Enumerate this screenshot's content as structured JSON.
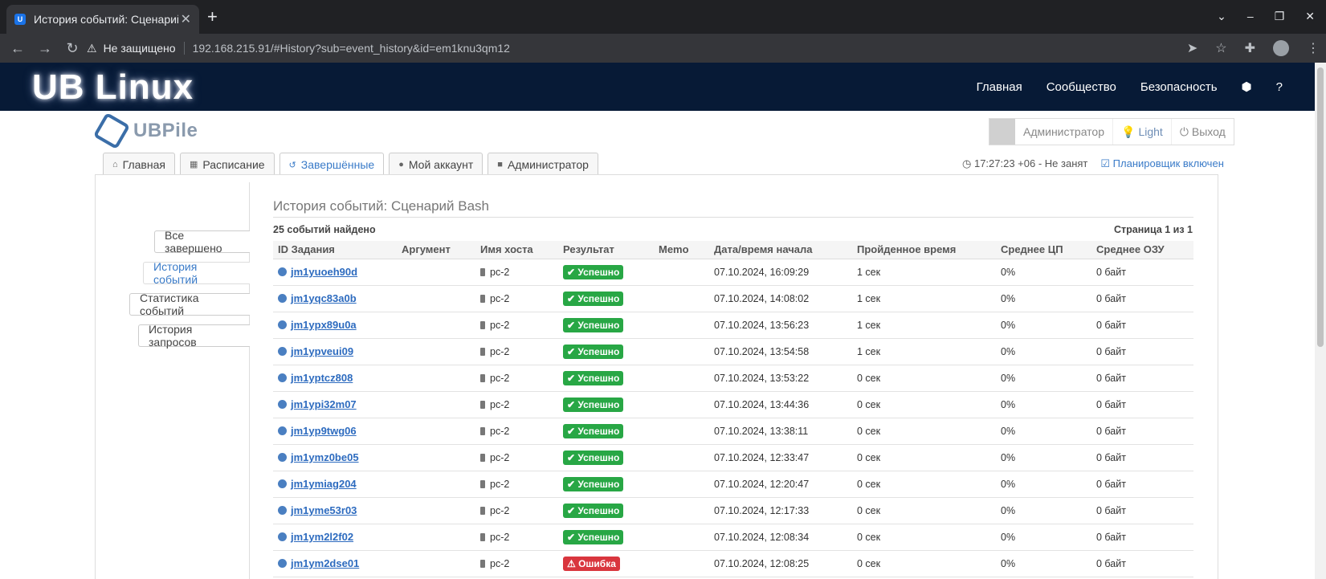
{
  "browser": {
    "tab_title": "История событий: Сценарий",
    "tab_favicon": "U",
    "security_label": "Не защищено",
    "url": "192.168.215.91/#History?sub=event_history&id=em1knu3qm12"
  },
  "site": {
    "logo": "UB Linux",
    "nav": [
      "Главная",
      "Сообщество",
      "Безопасность",
      "⬢",
      "?"
    ]
  },
  "app": {
    "name": "UBPile",
    "user": "Администратор",
    "theme": "Light",
    "logout": "Выход",
    "tabs": [
      "Главная",
      "Расписание",
      "Завершённые",
      "Мой аккаунт",
      "Администратор"
    ],
    "active_tab": 2,
    "time_status": "17:27:23 +06 - Не занят",
    "scheduler": "Планировщик включен"
  },
  "sidebar": {
    "items": [
      "Все завершено",
      "История событий",
      "Статистика событий",
      "История запросов"
    ],
    "active": 1
  },
  "content": {
    "title": "История событий: Сценарий Bash",
    "count": "25 событий найдено",
    "pager": "Страница 1 из 1",
    "columns": [
      "ID Задания",
      "Аргумент",
      "Имя хоста",
      "Результат",
      "Memo",
      "Дата/время начала",
      "Пройденное время",
      "Среднее ЦП",
      "Среднее ОЗУ"
    ],
    "rows": [
      {
        "id": "jm1yuoeh90d",
        "arg": "",
        "host": "pc-2",
        "result": "Успешно",
        "status": "ok",
        "memo": "",
        "start": "07.10.2024, 16:09:29",
        "elapsed": "1 сек",
        "cpu": "0%",
        "ram": "0 байт"
      },
      {
        "id": "jm1yqc83a0b",
        "arg": "",
        "host": "pc-2",
        "result": "Успешно",
        "status": "ok",
        "memo": "",
        "start": "07.10.2024, 14:08:02",
        "elapsed": "1 сек",
        "cpu": "0%",
        "ram": "0 байт"
      },
      {
        "id": "jm1ypx89u0a",
        "arg": "",
        "host": "pc-2",
        "result": "Успешно",
        "status": "ok",
        "memo": "",
        "start": "07.10.2024, 13:56:23",
        "elapsed": "1 сек",
        "cpu": "0%",
        "ram": "0 байт"
      },
      {
        "id": "jm1ypveui09",
        "arg": "",
        "host": "pc-2",
        "result": "Успешно",
        "status": "ok",
        "memo": "",
        "start": "07.10.2024, 13:54:58",
        "elapsed": "1 сек",
        "cpu": "0%",
        "ram": "0 байт"
      },
      {
        "id": "jm1yptcz808",
        "arg": "",
        "host": "pc-2",
        "result": "Успешно",
        "status": "ok",
        "memo": "",
        "start": "07.10.2024, 13:53:22",
        "elapsed": "0 сек",
        "cpu": "0%",
        "ram": "0 байт"
      },
      {
        "id": "jm1ypi32m07",
        "arg": "",
        "host": "pc-2",
        "result": "Успешно",
        "status": "ok",
        "memo": "",
        "start": "07.10.2024, 13:44:36",
        "elapsed": "0 сек",
        "cpu": "0%",
        "ram": "0 байт"
      },
      {
        "id": "jm1yp9twg06",
        "arg": "",
        "host": "pc-2",
        "result": "Успешно",
        "status": "ok",
        "memo": "",
        "start": "07.10.2024, 13:38:11",
        "elapsed": "0 сек",
        "cpu": "0%",
        "ram": "0 байт"
      },
      {
        "id": "jm1ymz0be05",
        "arg": "",
        "host": "pc-2",
        "result": "Успешно",
        "status": "ok",
        "memo": "",
        "start": "07.10.2024, 12:33:47",
        "elapsed": "0 сек",
        "cpu": "0%",
        "ram": "0 байт"
      },
      {
        "id": "jm1ymiag204",
        "arg": "",
        "host": "pc-2",
        "result": "Успешно",
        "status": "ok",
        "memo": "",
        "start": "07.10.2024, 12:20:47",
        "elapsed": "0 сек",
        "cpu": "0%",
        "ram": "0 байт"
      },
      {
        "id": "jm1yme53r03",
        "arg": "",
        "host": "pc-2",
        "result": "Успешно",
        "status": "ok",
        "memo": "",
        "start": "07.10.2024, 12:17:33",
        "elapsed": "0 сек",
        "cpu": "0%",
        "ram": "0 байт"
      },
      {
        "id": "jm1ym2l2f02",
        "arg": "",
        "host": "pc-2",
        "result": "Успешно",
        "status": "ok",
        "memo": "",
        "start": "07.10.2024, 12:08:34",
        "elapsed": "0 сек",
        "cpu": "0%",
        "ram": "0 байт"
      },
      {
        "id": "jm1ym2dse01",
        "arg": "",
        "host": "pc-2",
        "result": "Ошибка",
        "status": "err",
        "memo": "",
        "start": "07.10.2024, 12:08:25",
        "elapsed": "0 сек",
        "cpu": "0%",
        "ram": "0 байт"
      }
    ]
  },
  "colors": {
    "header_bg": "#071a36",
    "link": "#2d6bbf",
    "success": "#28a745",
    "error": "#d9363e"
  }
}
